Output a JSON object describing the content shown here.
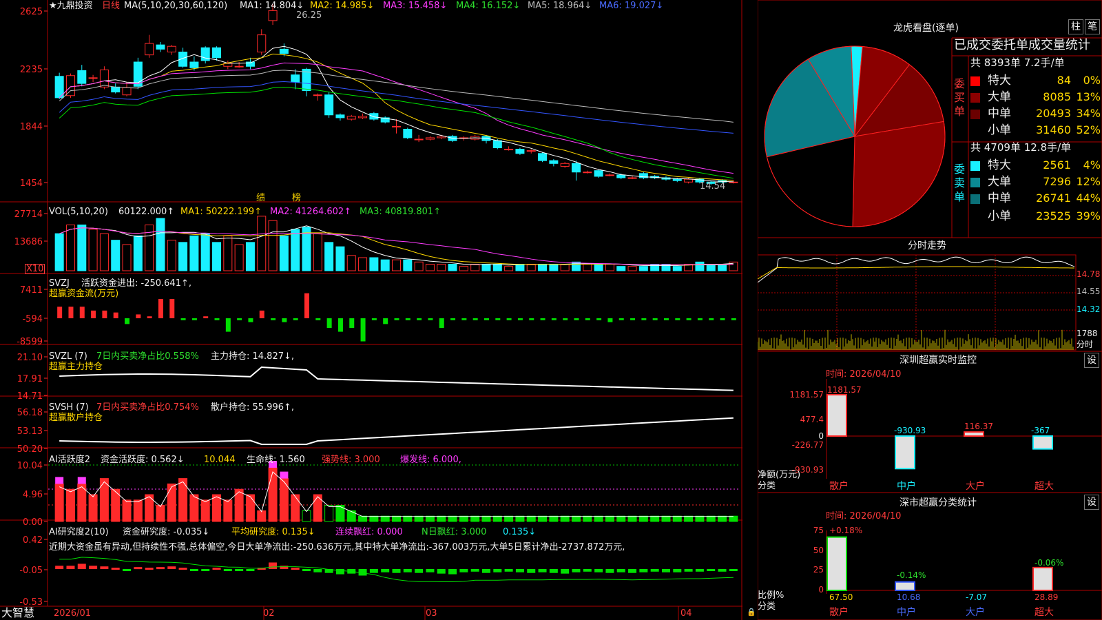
{
  "chart_data": [
    {
      "panel": "kline",
      "type": "candlestick",
      "ylim": [
        1350,
        2700
      ],
      "yticks": [
        "2625",
        "2235",
        "1844",
        "1454"
      ],
      "candles": [
        [
          2190,
          2040,
          2215,
          2030
        ],
        [
          2055,
          2195,
          2210,
          2040
        ],
        [
          2230,
          2140,
          2270,
          2120
        ],
        [
          2180,
          2180,
          2200,
          2150
        ],
        [
          2115,
          2235,
          2260,
          2100
        ],
        [
          2115,
          2080,
          2140,
          2070
        ],
        [
          2060,
          2110,
          2150,
          2050
        ],
        [
          2290,
          2120,
          2320,
          2100
        ],
        [
          2340,
          2420,
          2480,
          2320
        ],
        [
          2410,
          2380,
          2430,
          2360
        ],
        [
          2360,
          2400,
          2410,
          2340
        ],
        [
          2360,
          2260,
          2390,
          2250
        ],
        [
          2290,
          2250,
          2330,
          2230
        ],
        [
          2390,
          2300,
          2400,
          2280
        ],
        [
          2390,
          2320,
          2400,
          2300
        ],
        [
          2260,
          2280,
          2300,
          2240
        ],
        [
          2260,
          2260,
          2290,
          2250
        ],
        [
          2290,
          2260,
          2320,
          2240
        ],
        [
          2360,
          2480,
          2520,
          2340
        ],
        [
          2580,
          2650,
          2700,
          2550
        ],
        [
          2380,
          2350,
          2420,
          2330
        ],
        [
          2200,
          2150,
          2240,
          2100
        ],
        [
          2240,
          2090,
          2250,
          2050
        ],
        [
          2060,
          2060,
          2070,
          2020
        ],
        [
          2060,
          1920,
          2080,
          1900
        ],
        [
          1920,
          1900,
          1930,
          1880
        ],
        [
          1890,
          1910,
          1920,
          1880
        ],
        [
          1900,
          1910,
          1930,
          1890
        ],
        [
          1930,
          1890,
          1940,
          1880
        ],
        [
          1900,
          1870,
          1910,
          1860
        ],
        [
          1840,
          1840,
          1890,
          1790
        ],
        [
          1820,
          1760,
          1830,
          1750
        ],
        [
          1750,
          1750,
          1780,
          1730
        ],
        [
          1750,
          1760,
          1770,
          1740
        ],
        [
          1760,
          1770,
          1780,
          1750
        ],
        [
          1770,
          1740,
          1780,
          1730
        ],
        [
          1760,
          1760,
          1770,
          1740
        ],
        [
          1750,
          1770,
          1780,
          1740
        ],
        [
          1770,
          1740,
          1780,
          1720
        ],
        [
          1740,
          1690,
          1750,
          1680
        ],
        [
          1680,
          1680,
          1700,
          1670
        ],
        [
          1680,
          1650,
          1690,
          1640
        ],
        [
          1670,
          1670,
          1680,
          1650
        ],
        [
          1650,
          1600,
          1660,
          1590
        ],
        [
          1600,
          1580,
          1610,
          1560
        ],
        [
          1560,
          1580,
          1590,
          1550
        ],
        [
          1580,
          1520,
          1600,
          1460
        ],
        [
          1520,
          1520,
          1530,
          1510
        ],
        [
          1530,
          1490,
          1540,
          1480
        ],
        [
          1500,
          1500,
          1510,
          1490
        ],
        [
          1500,
          1480,
          1510,
          1470
        ],
        [
          1480,
          1480,
          1490,
          1470
        ],
        [
          1510,
          1480,
          1520,
          1470
        ],
        [
          1490,
          1480,
          1500,
          1470
        ],
        [
          1480,
          1470,
          1490,
          1460
        ],
        [
          1470,
          1460,
          1480,
          1450
        ],
        [
          1450,
          1470,
          1480,
          1440
        ],
        [
          1470,
          1450,
          1480,
          1440
        ],
        [
          1450,
          1440,
          1460,
          1430
        ],
        [
          1460,
          1450,
          1470,
          1440
        ],
        [
          1450,
          1450,
          1460,
          1440
        ]
      ],
      "labels": {
        "ma_title": "★九鼎投资",
        "period": "日线",
        "ma": "MA(5,10,20,30,60,120)",
        "ma1": "MA1: 14.804↓",
        "ma2": "MA2: 14.985↓",
        "ma3": "MA3: 15.458↓",
        "ma4": "MA4: 16.152↓",
        "ma5": "MA5: 18.964↓",
        "ma6": "MA6: 19.027↓",
        "high": "26.25",
        "low": "14.54",
        "note1": "绩",
        "note2": "榜"
      }
    },
    {
      "panel": "volume",
      "type": "bar",
      "ylim": [
        0,
        30000
      ],
      "yticks": [
        "27714",
        "13686"
      ],
      "unit": "X10",
      "values": [
        17000,
        21000,
        21000,
        19000,
        17000,
        14000,
        12000,
        16000,
        21000,
        24000,
        14000,
        13000,
        16000,
        17000,
        13000,
        16000,
        12000,
        13000,
        25000,
        23000,
        16000,
        19000,
        20000,
        17000,
        13000,
        11000,
        7000,
        6000,
        6000,
        5000,
        5000,
        5000,
        4000,
        3000,
        3000,
        3000,
        2000,
        3000,
        3000,
        3000,
        2000,
        3000,
        3000,
        3000,
        3000,
        3000,
        4000,
        3000,
        3000,
        3000,
        2000,
        2000,
        2000,
        3000,
        3000,
        2000,
        3000,
        4000,
        3000,
        3000,
        4000
      ],
      "labels": {
        "title": "VOL(5,10,20)",
        "v": "60122.000↑",
        "ma1": "MA1: 50222.199↑",
        "ma2": "MA2: 41264.602↑",
        "ma3": "MA3: 40819.801↑"
      }
    },
    {
      "panel": "svzj",
      "type": "bar",
      "ylim": [
        -9000,
        8000
      ],
      "yticks": [
        "7411",
        "-594",
        "-8599"
      ],
      "values": [
        3000,
        3000,
        3000,
        2000,
        2000,
        1500,
        -1500,
        1000,
        500,
        5000,
        5000,
        -500,
        -500,
        500,
        -500,
        -3500,
        -500,
        -1000,
        2000,
        -500,
        -1000,
        -500,
        6500,
        -500,
        -2500,
        -3500,
        -2500,
        -6000,
        -500,
        -1500,
        -500,
        -500,
        -500,
        -500,
        -2500,
        -500,
        -500,
        -500,
        -500,
        -500,
        -500,
        -500,
        -500,
        -500,
        -500,
        -500,
        -500,
        -500,
        -500,
        -1000,
        -500,
        -500,
        -500,
        -500,
        -500,
        -500,
        -500,
        -500,
        -500,
        -500,
        -500
      ],
      "labels": {
        "title": "SVZJ",
        "t2": "活跃资金进出: -250.641↑,",
        "t3": "超赢资金流(万元)"
      }
    },
    {
      "panel": "svzl",
      "type": "line",
      "ylim": [
        14.5,
        21.5
      ],
      "yticks": [
        "21.10",
        "17.91",
        "14.71"
      ],
      "labels": {
        "title": "SVZL (7)",
        "t2": "7日内买卖净占比0.558%",
        "t3": "主力持仓: 14.827↓,",
        "t4": "超赢主力持仓"
      }
    },
    {
      "panel": "svsh",
      "type": "line",
      "ylim": [
        49.5,
        57.5
      ],
      "yticks": [
        "56.18",
        "53.13",
        "50.20"
      ],
      "labels": {
        "title": "SVSH (7)",
        "t2": "7日内买卖净占比0.754%",
        "t3": "散户持仓: 55.996↑,",
        "t4": "超赢散户持仓"
      }
    },
    {
      "panel": "ai_activity",
      "type": "bar",
      "ylim": [
        0,
        11
      ],
      "yticks": [
        "10.04",
        "4.96",
        "0.00"
      ],
      "labels": {
        "title": "AI活跃度2",
        "t2": "资金活跃度: 0.562↓",
        "t3": "10.044",
        "t4": "生命线: 1.560",
        "t5": "强势线: 3.000",
        "t6": "爆发线: 6.000,"
      }
    },
    {
      "panel": "ai_research",
      "type": "line",
      "ylim": [
        -0.55,
        0.45
      ],
      "yticks": [
        "0.42",
        "-0.05",
        "-0.53"
      ],
      "labels": {
        "title": "AI研究度2(10)",
        "t2": "资金研究度: -0.035↓",
        "t3": "平均研究度: 0.135↓",
        "t4": "连续飘红: 0.000",
        "t5": "N日飘红: 3.000",
        "t6": "0.135↓"
      },
      "note": "近期大资金虽有异动,但持续性不强,总体偏空,今日大单净流出:-250.636万元,其中特大单净流出:-367.003万元,大单5日累计净出-2737.872万元,"
    },
    {
      "panel": "xaxis",
      "labels": [
        "2026/01",
        "02",
        "03",
        "04"
      ],
      "brand": "大智慧"
    },
    {
      "panel": "dragon_tiger",
      "type": "pie",
      "title": "龙虎看盘(逐单)",
      "buttons": [
        "柱",
        "笔"
      ],
      "heading": "已成交委托单成交量统计",
      "buy": {
        "summary": "共 8393单 7.2手/单",
        "side": "委买单",
        "rows": [
          [
            "特大",
            "84",
            "0%"
          ],
          [
            "大单",
            "8085",
            "13%"
          ],
          [
            "中单",
            "20493",
            "34%"
          ],
          [
            "小单",
            "31460",
            "52%"
          ]
        ]
      },
      "sell": {
        "summary": "共 4709单 12.8手/单",
        "side": "委卖单",
        "rows": [
          [
            "特大",
            "2561",
            "4%"
          ],
          [
            "大单",
            "7296",
            "12%"
          ],
          [
            "中单",
            "26741",
            "44%"
          ],
          [
            "小单",
            "23525",
            "39%"
          ]
        ]
      }
    },
    {
      "panel": "intraday",
      "type": "line",
      "title": "分时走势",
      "yticks": [
        "14.78",
        "14.55",
        "14.32",
        "1788",
        "分时"
      ]
    },
    {
      "panel": "sz_monitor",
      "type": "bar",
      "title": "深圳超赢实时监控",
      "btn": "设",
      "time": "时间: 2026/04/10",
      "yticks": [
        "1181.57",
        "477.4",
        "0",
        "-226.77",
        "-930.93"
      ],
      "ylabel": "净额(万元)",
      "ylabel2": "分类",
      "categories": [
        "散户",
        "中户",
        "大户",
        "超大"
      ],
      "values": [
        1181.57,
        -930.93,
        116.37,
        -367
      ],
      "value_labels": [
        "1181.57",
        "-930.93",
        "116.37",
        "-367"
      ]
    },
    {
      "panel": "sz_classify",
      "type": "bar",
      "title": "深市超赢分类统计",
      "btn": "设",
      "time": "时间: 2026/04/10",
      "yticks": [
        "75",
        "50",
        "25",
        "0"
      ],
      "ylabel": "比例%",
      "ylabel2": "分类",
      "categories": [
        "散户",
        "中户",
        "大户",
        "超大"
      ],
      "values": [
        67.5,
        10.68,
        -7.07,
        28.89
      ],
      "value_labels": [
        "67.50",
        "10.68",
        "-7.07",
        "28.89"
      ],
      "change_labels": [
        "+0.18%",
        "-0.14%",
        "",
        "-0.06%"
      ]
    }
  ]
}
